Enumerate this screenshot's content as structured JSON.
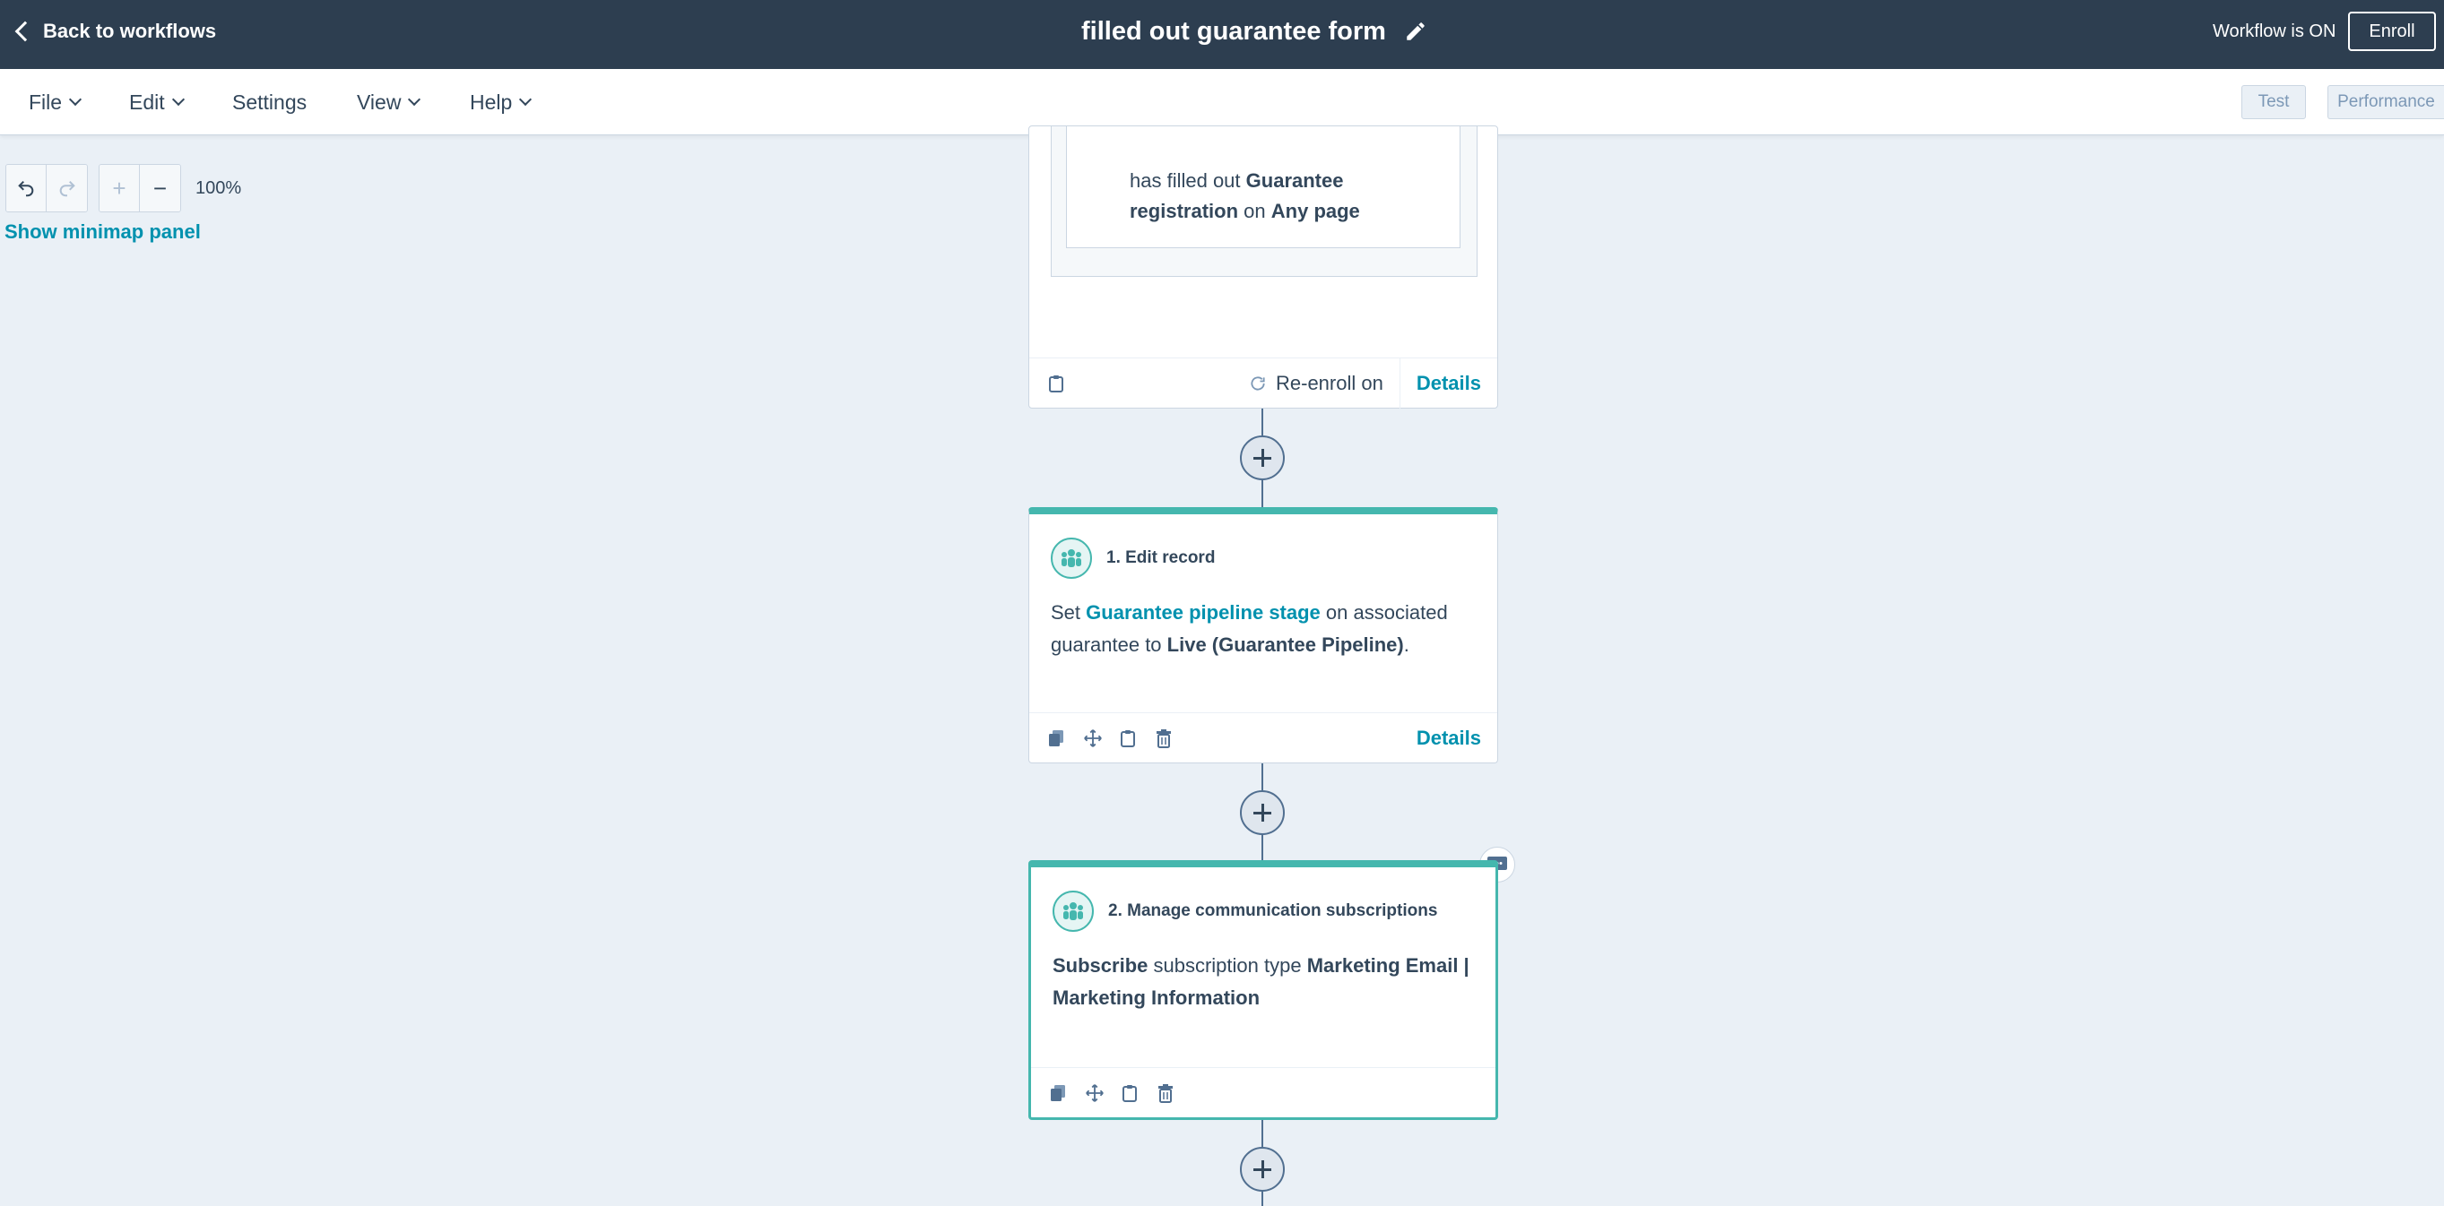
{
  "topbar": {
    "back_label": "Back to workflows",
    "title": "filled out guarantee form",
    "status": "Workflow is ON",
    "enroll_label": "Enroll"
  },
  "menu": {
    "file": "File",
    "edit": "Edit",
    "settings": "Settings",
    "view": "View",
    "help": "Help",
    "test": "Test",
    "performance": "Performance"
  },
  "canvas": {
    "zoom": "100%",
    "minimap_label": "Show minimap panel"
  },
  "trigger": {
    "prefix": "has filled out",
    "form_name": "Guarantee registration",
    "on_word": "on",
    "page": "Any page",
    "reenroll_label": "Re-enroll on",
    "details_label": "Details"
  },
  "actions": [
    {
      "title": "1. Edit record",
      "set_word": "Set",
      "property": "Guarantee pipeline stage",
      "mid_text": "on associated guarantee to",
      "value": "Live (Guarantee Pipeline)",
      "end": ".",
      "details_label": "Details"
    },
    {
      "title": "2. Manage communication subscriptions",
      "verb": "Subscribe",
      "mid_text": "subscription type",
      "value": "Marketing Email | Marketing Information"
    }
  ],
  "colors": {
    "topbar": "#2d3e50",
    "accent_teal": "#45b7ae",
    "link": "#0091ae",
    "canvas_bg": "#eaf0f6"
  }
}
